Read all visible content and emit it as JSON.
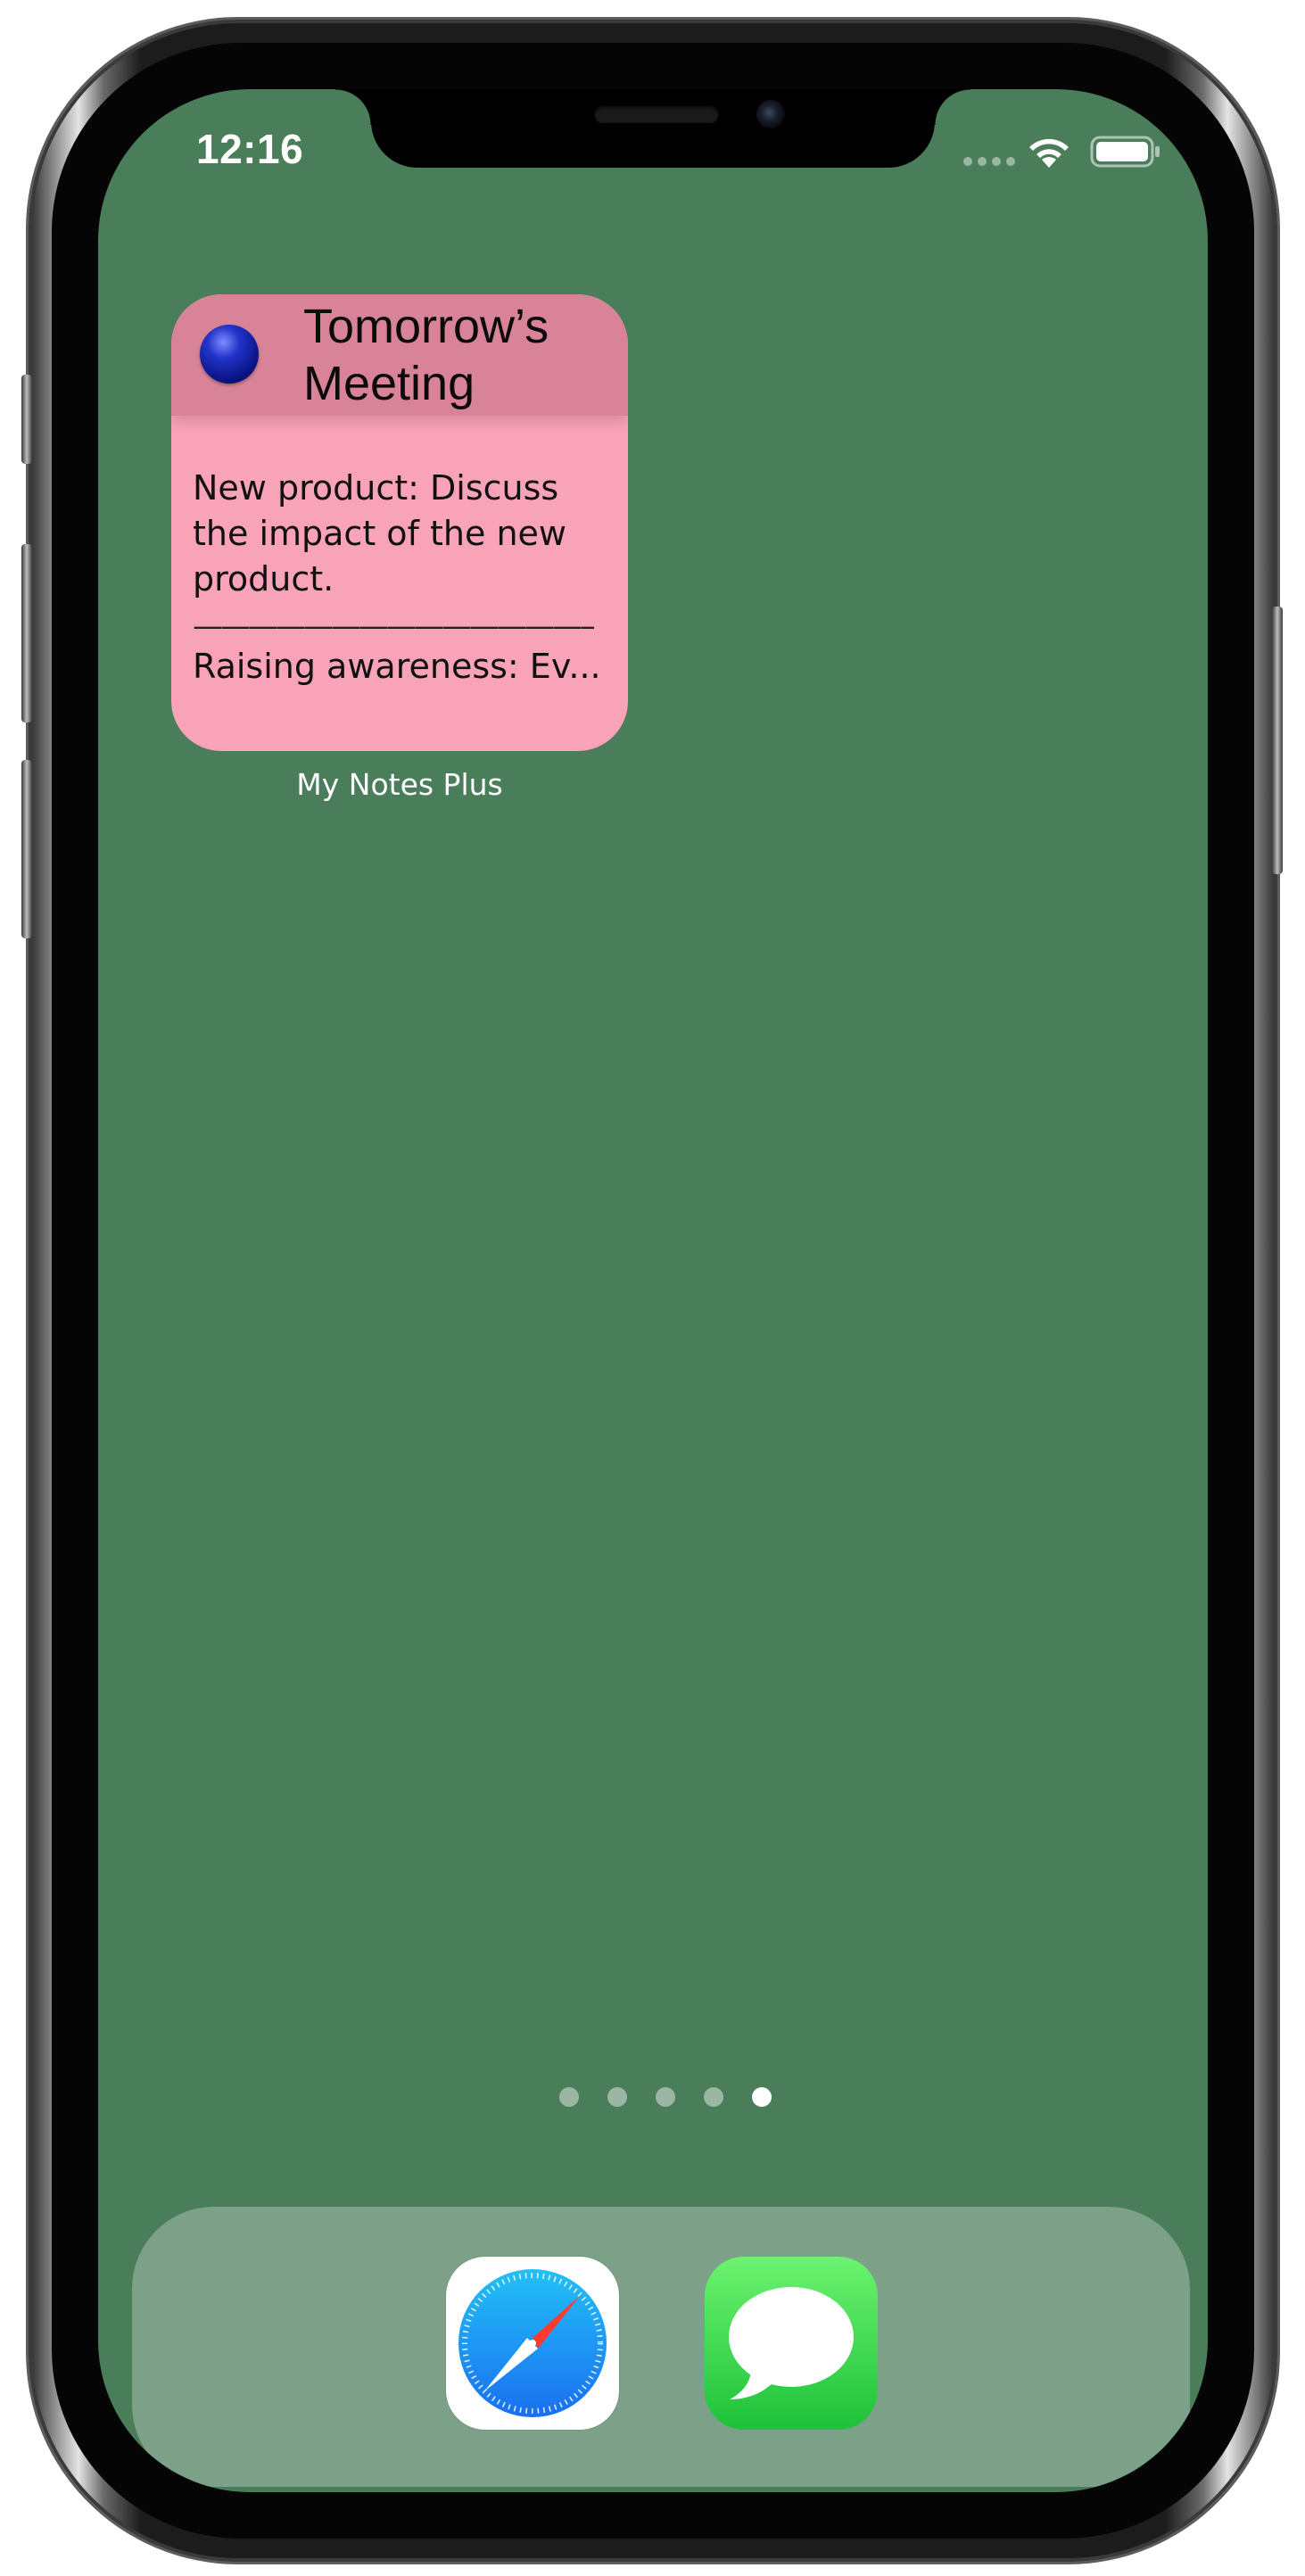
{
  "status_bar": {
    "time": "12:16",
    "wifi_icon": "wifi-icon",
    "battery_icon": "battery-icon",
    "cellular_icon": "cellular-signal-icon"
  },
  "widget": {
    "title": "Tomorrow’s Meeting",
    "pin_icon": "blue-pin-icon",
    "body_text": "New product: Discuss the impact of the new product.",
    "separator": "————————————————",
    "last_line": "Raising awareness: Ev...",
    "app_label": "My Notes Plus",
    "colors": {
      "background": "#f8a3b8",
      "header": "#d98398"
    }
  },
  "page_indicator": {
    "total": 5,
    "active_index": 4
  },
  "dock": {
    "apps": [
      {
        "name": "Safari",
        "icon": "safari-compass-icon"
      },
      {
        "name": "Messages",
        "icon": "messages-bubble-icon"
      }
    ]
  },
  "wallpaper_color": "#4a7d5a"
}
